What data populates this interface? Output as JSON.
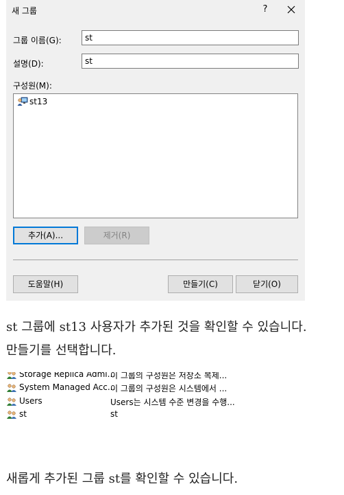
{
  "dialog": {
    "title": "새 그룹",
    "help_label": "?",
    "group_name_label": "그룹 이름(G):",
    "group_name_value": "st",
    "description_label": "설명(D):",
    "description_value": "st",
    "members_label": "구성원(M):",
    "members": [
      {
        "name": "st13",
        "icon": "user-icon"
      }
    ],
    "buttons": {
      "add": "추가(A)...",
      "remove": "제거(R)",
      "help": "도움말(H)",
      "create": "만들기(C)",
      "close": "닫기(O)"
    }
  },
  "captions": {
    "line1": "st 그룹에 st13 사용자가 추가된 것을 확인할 수 있습니다.",
    "line2": "만들기를 선택합니다.",
    "line3": "새롭게 추가된 그룹 st를 확인할 수 있습니다."
  },
  "groups_list": [
    {
      "name": "Storage Replica Admi...",
      "desc": "이 그룹의 구성원은 저장소 복제...",
      "icon": "group-icon"
    },
    {
      "name": "System Managed Acc...",
      "desc": "이 그룹의 구성원은 시스템에서 ...",
      "icon": "group-icon"
    },
    {
      "name": "Users",
      "desc": "Users는 시스템 수준 변경을 수행...",
      "icon": "group-icon"
    },
    {
      "name": "st",
      "desc": "st",
      "icon": "group-icon"
    }
  ],
  "colors": {
    "dialog_bg": "#f0f0f0",
    "focus_border": "#0078d7"
  }
}
